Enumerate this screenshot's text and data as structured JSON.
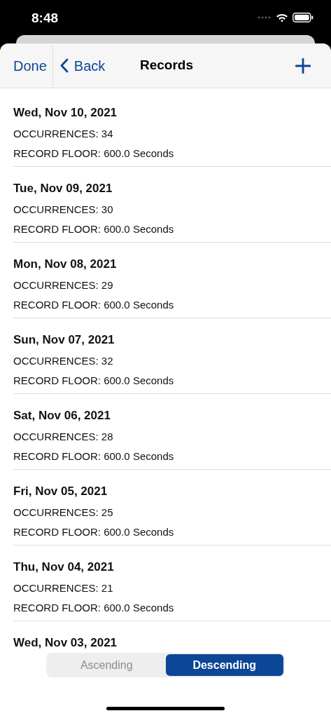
{
  "status_bar": {
    "time": "8:48"
  },
  "nav": {
    "done": "Done",
    "back": "Back",
    "title": "Records"
  },
  "records": [
    {
      "date": "Wed, Nov 10, 2021",
      "occurrences": "OCCURRENCES: 34",
      "floor": "RECORD FLOOR: 600.0 Seconds"
    },
    {
      "date": "Tue, Nov 09, 2021",
      "occurrences": "OCCURRENCES: 30",
      "floor": "RECORD FLOOR: 600.0 Seconds"
    },
    {
      "date": "Mon, Nov 08, 2021",
      "occurrences": "OCCURRENCES: 29",
      "floor": "RECORD FLOOR: 600.0 Seconds"
    },
    {
      "date": "Sun, Nov 07, 2021",
      "occurrences": "OCCURRENCES: 32",
      "floor": "RECORD FLOOR: 600.0 Seconds"
    },
    {
      "date": "Sat, Nov 06, 2021",
      "occurrences": "OCCURRENCES: 28",
      "floor": "RECORD FLOOR: 600.0 Seconds"
    },
    {
      "date": "Fri, Nov 05, 2021",
      "occurrences": "OCCURRENCES: 25",
      "floor": "RECORD FLOOR: 600.0 Seconds"
    },
    {
      "date": "Thu, Nov 04, 2021",
      "occurrences": "OCCURRENCES: 21",
      "floor": "RECORD FLOOR: 600.0 Seconds"
    },
    {
      "date": "Wed, Nov 03, 2021"
    }
  ],
  "sort": [
    {
      "label": "Ascending",
      "selected": false
    },
    {
      "label": "Descending",
      "selected": true
    }
  ]
}
